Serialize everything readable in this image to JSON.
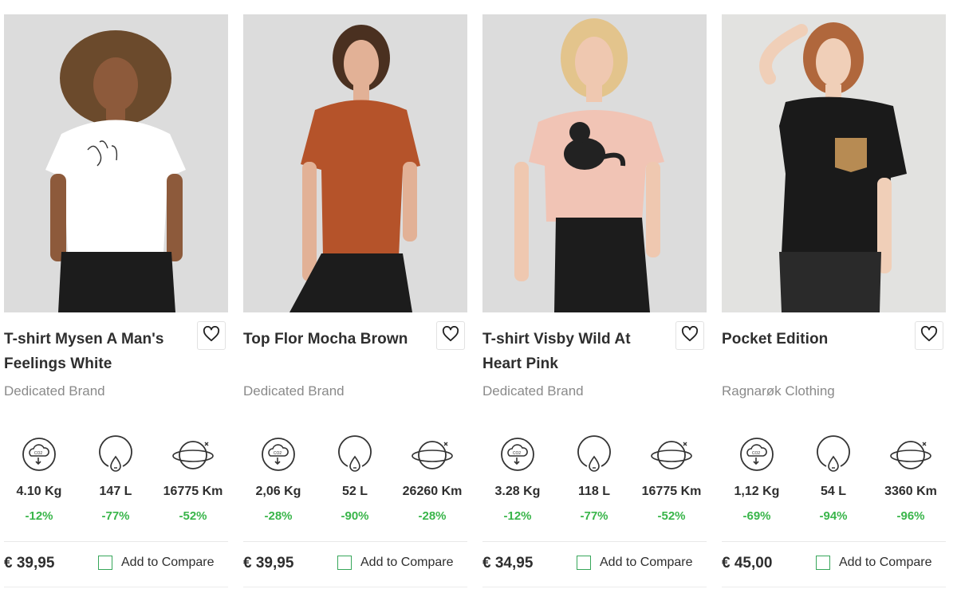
{
  "products": [
    {
      "title": "T-shirt Mysen A Man's Feelings White",
      "brand": "Dedicated Brand",
      "co2": "4.10 Kg",
      "co2_pct": "-12%",
      "water": "147 L",
      "water_pct": "-77%",
      "distance": "16775 Km",
      "distance_pct": "-52%",
      "price": "€ 39,95",
      "compare_label": "Add to Compare"
    },
    {
      "title": "Top Flor Mocha Brown",
      "brand": "Dedicated Brand",
      "co2": "2,06 Kg",
      "co2_pct": "-28%",
      "water": "52 L",
      "water_pct": "-90%",
      "distance": "26260 Km",
      "distance_pct": "-28%",
      "price": "€ 39,95",
      "compare_label": "Add to Compare"
    },
    {
      "title": "T-shirt Visby Wild At Heart Pink",
      "brand": "Dedicated Brand",
      "co2": "3.28 Kg",
      "co2_pct": "-12%",
      "water": "118 L",
      "water_pct": "-77%",
      "distance": "16775 Km",
      "distance_pct": "-52%",
      "price": "€ 34,95",
      "compare_label": "Add to Compare"
    },
    {
      "title": "Pocket Edition",
      "brand": "Ragnarøk Clothing",
      "co2": "1,12 Kg",
      "co2_pct": "-69%",
      "water": "54 L",
      "water_pct": "-94%",
      "distance": "3360 Km",
      "distance_pct": "-96%",
      "price": "€ 45,00",
      "compare_label": "Add to Compare"
    }
  ],
  "icons": {
    "co2": "co2-cloud-icon",
    "water": "water-drop-icon",
    "distance": "globe-orbit-icon",
    "wishlist": "heart-icon",
    "co2_glyph": "CO2"
  },
  "colors": {
    "savings_green": "#39b54a",
    "checkbox_border": "#37a65a",
    "photo_bg": "#dcdcdc",
    "shirt_colors": [
      "#ffffff",
      "#b5532a",
      "#f1c4b5",
      "#1a1a1a"
    ]
  }
}
